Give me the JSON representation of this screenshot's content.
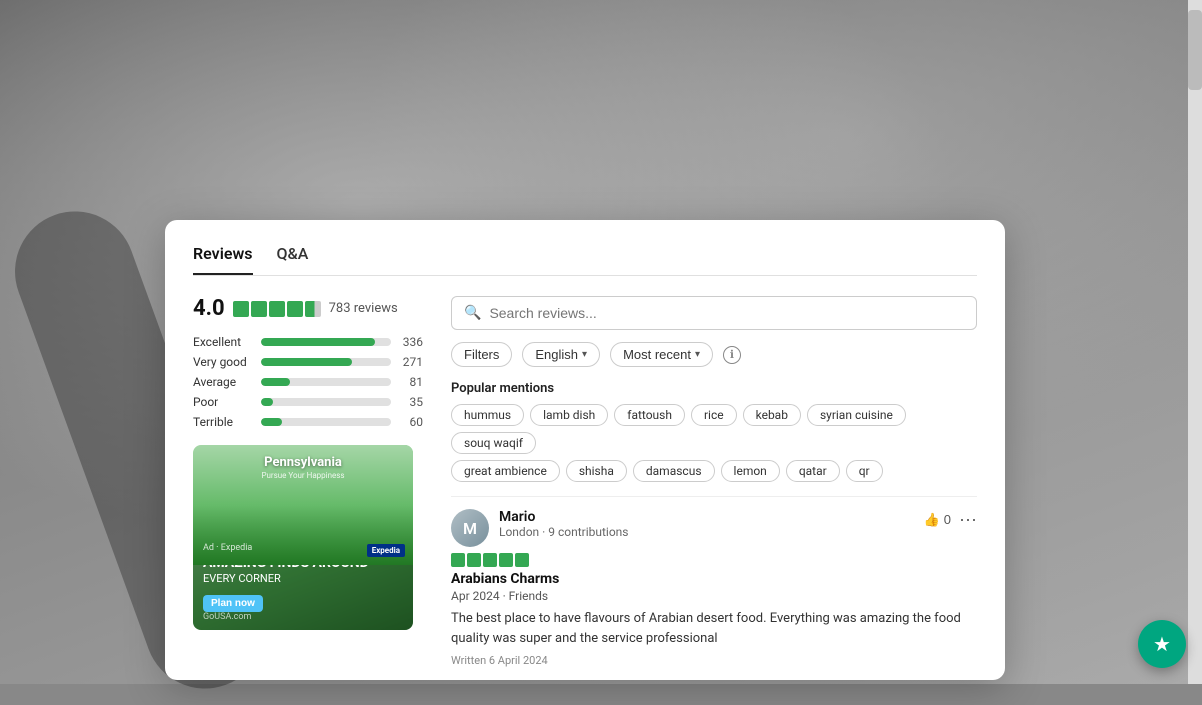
{
  "background": {
    "color": "#888888"
  },
  "tabs": {
    "items": [
      {
        "label": "Reviews",
        "active": true
      },
      {
        "label": "Q&A",
        "active": false
      }
    ]
  },
  "rating": {
    "score": "4.0",
    "review_count": "783 reviews",
    "stars": 4
  },
  "bars": [
    {
      "label": "Excellent",
      "count": "336",
      "pct": 88
    },
    {
      "label": "Very good",
      "count": "271",
      "pct": 70
    },
    {
      "label": "Average",
      "count": "81",
      "pct": 22
    },
    {
      "label": "Poor",
      "count": "35",
      "pct": 9
    },
    {
      "label": "Terrible",
      "count": "60",
      "pct": 16
    }
  ],
  "ad": {
    "small_text": "Ad · Expedia",
    "label": "Ad",
    "title": "Pennsylvania",
    "subtitle_1": "Pursue Your Happiness",
    "subtitle_2": "AMAZING FINDS AROUND",
    "subtitle_3": "EVERY CORNER",
    "button_label": "Plan now",
    "source": "GoUSA.com"
  },
  "search": {
    "placeholder": "Search reviews..."
  },
  "filters": {
    "filters_label": "Filters",
    "language_label": "English",
    "sort_label": "Most recent"
  },
  "popular_mentions": {
    "title": "Popular mentions",
    "tags_row1": [
      "hummus",
      "lamb dish",
      "fattoush",
      "rice",
      "kebab",
      "syrian cuisine",
      "souq waqif"
    ],
    "tags_row2": [
      "great ambience",
      "shisha",
      "damascus",
      "lemon",
      "qatar",
      "qr"
    ]
  },
  "review": {
    "reviewer_name": "Mario",
    "reviewer_meta": "London · 9 contributions",
    "like_count": "0",
    "stars": 5,
    "title": "Arabians Charms",
    "trip_type": "Apr 2024 · Friends",
    "text": "The best place to have flavours of Arabian desert food. Everything was amazing the food quality was super and the service professional",
    "written_date": "Written 6 April 2024"
  },
  "floating_btn": {
    "icon": "★"
  }
}
